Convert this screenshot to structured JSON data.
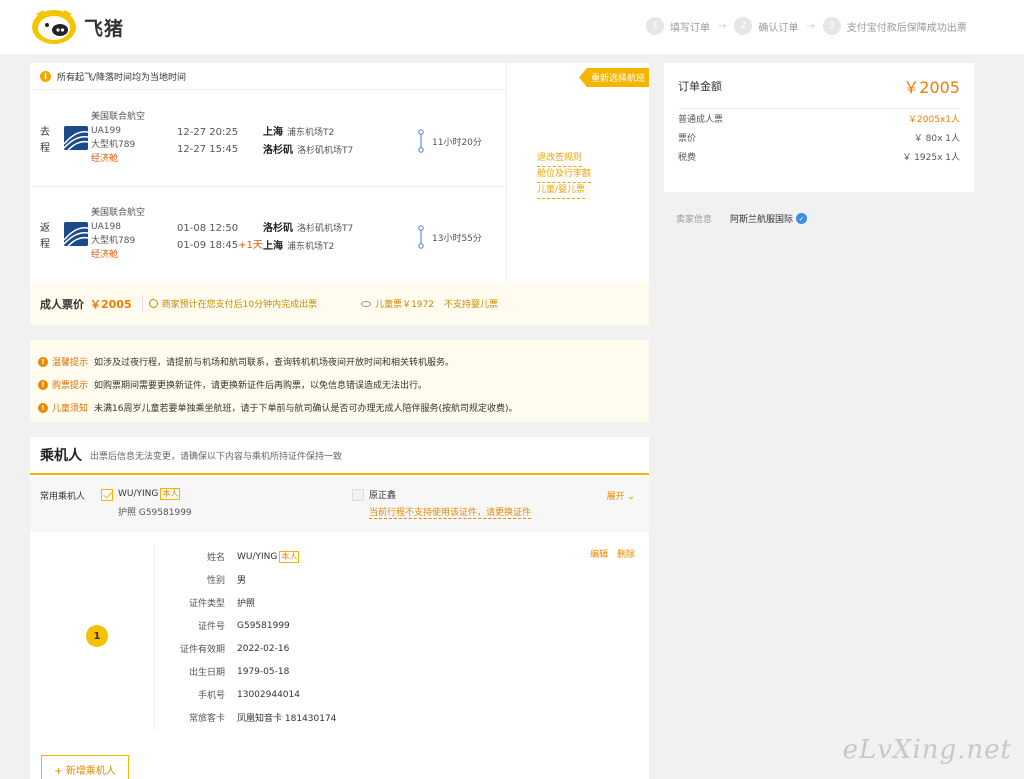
{
  "header": {
    "brand": "飞猪",
    "steps": [
      {
        "num": "1",
        "label": "填写订单"
      },
      {
        "num": "2",
        "label": "确认订单"
      },
      {
        "num": "3",
        "label": "支付宝付款后保障成功出票"
      }
    ]
  },
  "flight": {
    "notice": "所有起飞/降落时间均为当地时间",
    "rebook_button": "重新选择航班",
    "rebook_links": [
      "退改签规则",
      "舱位及行李额",
      "儿童/婴儿票"
    ],
    "outbound": {
      "tag": "去程",
      "airline": "美国联合航空",
      "flight_no": "UA199",
      "aircraft": "大型机789",
      "cabin": "经济舱",
      "dep_time": "12-27 20:25",
      "arr_time": "12-27 15:45",
      "arr_plus": "",
      "dep_city": "上海",
      "dep_airport": "浦东机场T2",
      "arr_city": "洛杉矶",
      "arr_airport": "洛杉矶机场T7",
      "duration": "11小时20分"
    },
    "inbound": {
      "tag": "返程",
      "airline": "美国联合航空",
      "flight_no": "UA198",
      "aircraft": "大型机789",
      "cabin": "经济舱",
      "dep_time": "01-08 12:50",
      "arr_time": "01-09 18:45",
      "arr_plus": "+1天",
      "dep_city": "洛杉矶",
      "dep_airport": "洛杉矶机场T7",
      "arr_city": "上海",
      "arr_airport": "浦东机场T2",
      "duration": "13小时55分"
    },
    "price_bar": {
      "label": "成人票价",
      "amount": "￥2005",
      "tip": "商家预计在您支付后10分钟内完成出票",
      "child": "儿童票￥1972",
      "infant": "不支持婴儿票"
    }
  },
  "tips": [
    {
      "head": "温馨提示",
      "text": "如涉及过夜行程，请提前与机场和航司联系，查询转机机场夜间开放时间和相关转机服务。"
    },
    {
      "head": "购票提示",
      "text": "如购票期间需要更换新证件，请更换新证件后再购票，以免信息错误造成无法出行。"
    },
    {
      "head": "儿童须知",
      "text": "未满16周岁儿童若要单独乘坐航班，请于下单前与航司确认是否可办理无成人陪伴服务(按航司规定收费)。"
    }
  ],
  "passengers": {
    "title": "乘机人",
    "subtitle": "出票后信息无法变更，请确保以下内容与乘机所持证件保持一致",
    "frequent_label": "常用乘机人",
    "p1_name": "WU/YING",
    "self_tag": "本人",
    "p1_doc": "护照   G59581999",
    "p2_name": "原正鑫",
    "p2_warn": "当前行程不支持使用该证件，请更换证件",
    "expand": "展开",
    "badge": "1",
    "edit": "编辑",
    "delete": "删除",
    "fields": [
      {
        "k": "姓名",
        "v": "WU/YING"
      },
      {
        "k": "性别",
        "v": "男"
      },
      {
        "k": "证件类型",
        "v": "护照"
      },
      {
        "k": "证件号",
        "v": "G59581999"
      },
      {
        "k": "证件有效期",
        "v": "2022-02-16"
      },
      {
        "k": "出生日期",
        "v": "1979-05-18"
      },
      {
        "k": "手机号",
        "v": "13002944014"
      },
      {
        "k": "常旅客卡",
        "v": "凤凰知音卡 181430174"
      }
    ],
    "add_button": "+ 新增乘机人"
  },
  "order": {
    "title": "订单金额",
    "total": "￥2005",
    "rows": [
      {
        "label": "普通成人票",
        "value": "￥2005x1人"
      },
      {
        "label": "票价",
        "value": "￥ 80x 1人"
      },
      {
        "label": "税费",
        "value": "￥ 1925x 1人"
      }
    ]
  },
  "seller": {
    "label": "卖家信息",
    "name": "阿斯兰航服国际"
  },
  "watermark": "eLvXing.net",
  "colors": {
    "accent": "#f4b400",
    "price": "#f27c00",
    "link": "#e68a00"
  }
}
